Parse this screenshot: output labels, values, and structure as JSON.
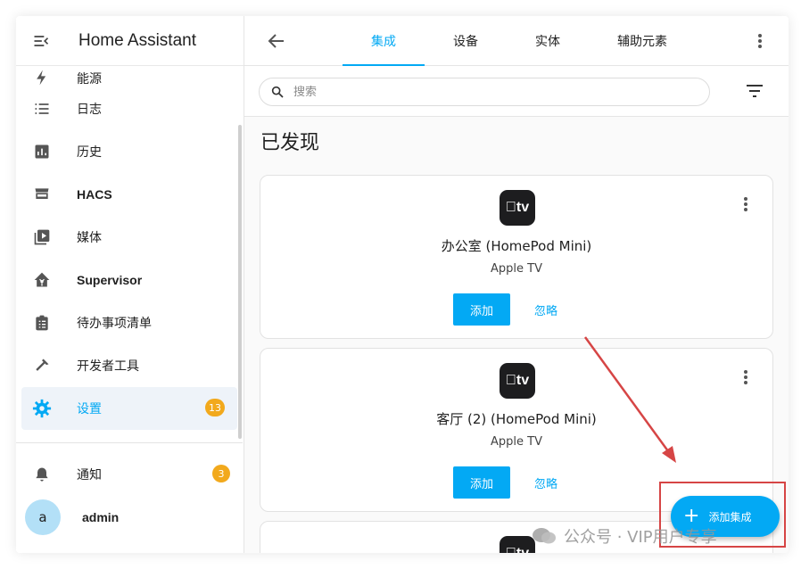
{
  "app": {
    "title": "Home Assistant"
  },
  "sidebar": {
    "items": [
      {
        "label": "能源",
        "icon": "lightning-icon"
      },
      {
        "label": "日志",
        "icon": "list-icon"
      },
      {
        "label": "历史",
        "icon": "chart-bar-icon"
      },
      {
        "label": "HACS",
        "icon": "hacs-store-icon"
      },
      {
        "label": "媒体",
        "icon": "play-box-icon"
      },
      {
        "label": "Supervisor",
        "icon": "supervisor-icon"
      },
      {
        "label": "待办事项清单",
        "icon": "clipboard-list-icon"
      },
      {
        "label": "开发者工具",
        "icon": "hammer-icon"
      },
      {
        "label": "设置",
        "icon": "gear-icon",
        "badge": "13",
        "active": true
      }
    ],
    "bottom": [
      {
        "label": "通知",
        "icon": "bell-icon",
        "badge": "3"
      },
      {
        "label": "admin",
        "avatar": "a"
      }
    ]
  },
  "topbar": {
    "tabs": [
      {
        "label": "集成",
        "active": true
      },
      {
        "label": "设备"
      },
      {
        "label": "实体"
      },
      {
        "label": "辅助元素"
      }
    ]
  },
  "search": {
    "placeholder": "搜索"
  },
  "discovered": {
    "title": "已发现",
    "cards": [
      {
        "logo": "tv",
        "name": "办公室 (HomePod Mini)",
        "subtitle": "Apple TV",
        "add_label": "添加",
        "ignore_label": "忽略"
      },
      {
        "logo": "tv",
        "name": "客厅 (2) (HomePod Mini)",
        "subtitle": "Apple TV",
        "add_label": "添加",
        "ignore_label": "忽略"
      },
      {
        "logo": "tv"
      }
    ]
  },
  "fab": {
    "label": "添加集成"
  },
  "watermark": {
    "text": "公众号 · VIP用户专享"
  },
  "colors": {
    "accent": "#03a9f4",
    "badge": "#f2a91c",
    "annotation": "#d64545"
  }
}
